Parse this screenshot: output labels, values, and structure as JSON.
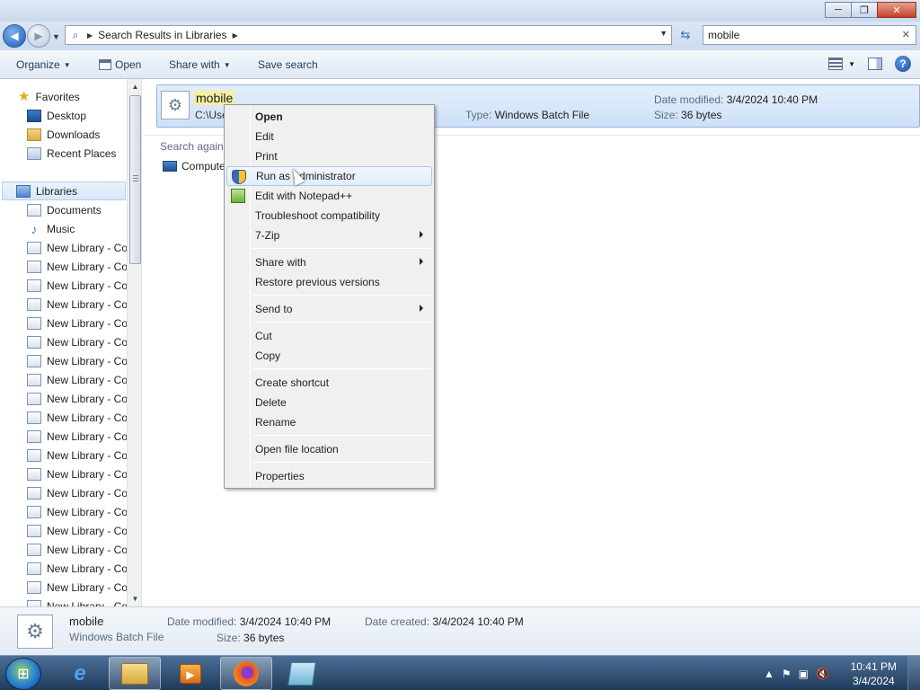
{
  "window": {
    "minimize": "─",
    "maximize": "❐",
    "close": "✕"
  },
  "address": {
    "crumb": "Search Results in Libraries",
    "search_value": "mobile"
  },
  "toolbar": {
    "organize": "Organize",
    "open": "Open",
    "share_with": "Share with",
    "save_search": "Save search"
  },
  "nav": {
    "favorites": "Favorites",
    "desktop": "Desktop",
    "downloads": "Downloads",
    "recent": "Recent Places",
    "libraries": "Libraries",
    "documents": "Documents",
    "music": "Music",
    "new_library": "New Library - Co",
    "new_library_partial": "New Library - Co"
  },
  "result": {
    "name": "mobile",
    "path": "C:\\Use",
    "type_label": "Type:",
    "type_value": "Windows Batch File",
    "modified_label": "Date modified:",
    "modified_value": "3/4/2024 10:40 PM",
    "size_label": "Size:",
    "size_value": "36 bytes"
  },
  "search_again": "Search again",
  "computer": "Compute",
  "details": {
    "name": "mobile",
    "type": "Windows Batch File",
    "modified_label": "Date modified:",
    "modified_value": "3/4/2024 10:40 PM",
    "size_label": "Size:",
    "size_value": "36 bytes",
    "created_label": "Date created:",
    "created_value": "3/4/2024 10:40 PM"
  },
  "context_menu": {
    "open": "Open",
    "edit": "Edit",
    "print": "Print",
    "run_as_admin": "Run as administrator",
    "edit_npp": "Edit with Notepad++",
    "troubleshoot": "Troubleshoot compatibility",
    "zip": "7-Zip",
    "share_with": "Share with",
    "restore": "Restore previous versions",
    "send_to": "Send to",
    "cut": "Cut",
    "copy": "Copy",
    "create_shortcut": "Create shortcut",
    "delete": "Delete",
    "rename": "Rename",
    "open_location": "Open file location",
    "properties": "Properties"
  },
  "taskbar": {
    "time": "10:41 PM",
    "date": "3/4/2024"
  }
}
